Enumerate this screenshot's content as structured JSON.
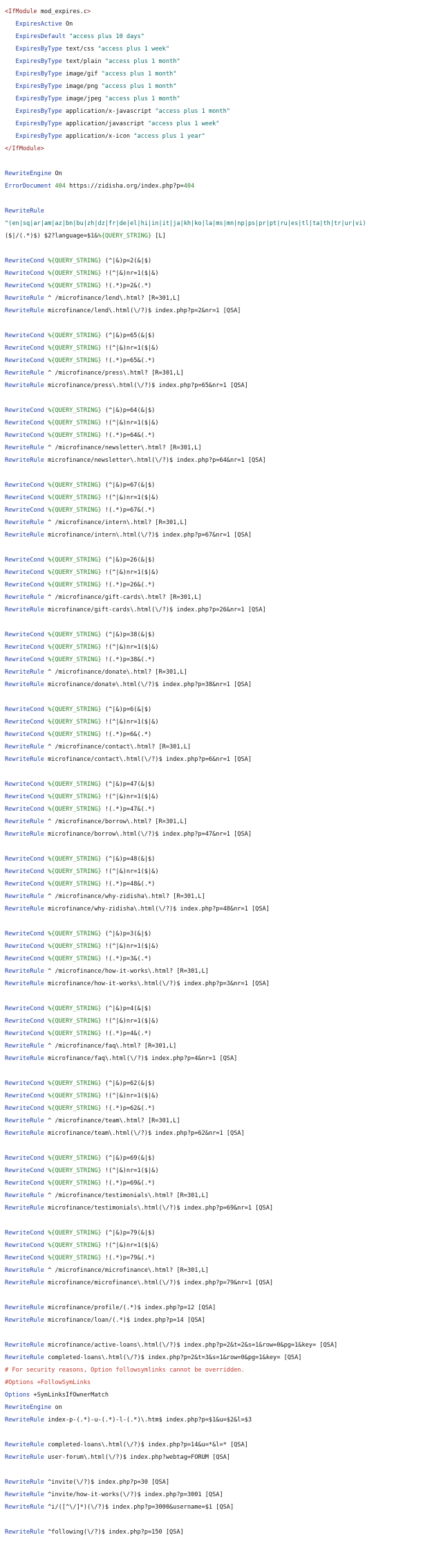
{
  "colors": {
    "background": "#ffffff",
    "tag": "#8b1a1a",
    "directive": "#1a3ea6",
    "variable": "#2d7d2d",
    "number": "#2d7d2d",
    "string": "#0a6b6b",
    "text": "#111111",
    "comment": "#c0392b"
  },
  "lines": [
    [
      [
        "tag",
        "<IfModule"
      ],
      [
        "txt",
        " mod_expires.c"
      ],
      [
        "tag",
        ">"
      ]
    ],
    [
      [
        "txt",
        "   "
      ],
      [
        "dir",
        "ExpiresActive"
      ],
      [
        "txt",
        " On"
      ]
    ],
    [
      [
        "txt",
        "   "
      ],
      [
        "dir",
        "ExpiresDefault"
      ],
      [
        "str",
        " \"access plus 10 days\""
      ]
    ],
    [
      [
        "txt",
        "   "
      ],
      [
        "dir",
        "ExpiresByType"
      ],
      [
        "txt",
        " text/css "
      ],
      [
        "str",
        "\"access plus 1 week\""
      ]
    ],
    [
      [
        "txt",
        "   "
      ],
      [
        "dir",
        "ExpiresByType"
      ],
      [
        "txt",
        " text/plain "
      ],
      [
        "str",
        "\"access plus 1 month\""
      ]
    ],
    [
      [
        "txt",
        "   "
      ],
      [
        "dir",
        "ExpiresByType"
      ],
      [
        "txt",
        " image/gif "
      ],
      [
        "str",
        "\"access plus 1 month\""
      ]
    ],
    [
      [
        "txt",
        "   "
      ],
      [
        "dir",
        "ExpiresByType"
      ],
      [
        "txt",
        " image/png "
      ],
      [
        "str",
        "\"access plus 1 month\""
      ]
    ],
    [
      [
        "txt",
        "   "
      ],
      [
        "dir",
        "ExpiresByType"
      ],
      [
        "txt",
        " image/jpeg "
      ],
      [
        "str",
        "\"access plus 1 month\""
      ]
    ],
    [
      [
        "txt",
        "   "
      ],
      [
        "dir",
        "ExpiresByType"
      ],
      [
        "txt",
        " application/x-javascript "
      ],
      [
        "str",
        "\"access plus 1 month\""
      ]
    ],
    [
      [
        "txt",
        "   "
      ],
      [
        "dir",
        "ExpiresByType"
      ],
      [
        "txt",
        " application/javascript "
      ],
      [
        "str",
        "\"access plus 1 week\""
      ]
    ],
    [
      [
        "txt",
        "   "
      ],
      [
        "dir",
        "ExpiresByType"
      ],
      [
        "txt",
        " application/x-icon "
      ],
      [
        "str",
        "\"access plus 1 year\""
      ]
    ],
    [
      [
        "tag",
        "</IfModule>"
      ]
    ],
    [],
    [
      [
        "dir",
        "RewriteEngine"
      ],
      [
        "txt",
        " On"
      ]
    ],
    [
      [
        "dir",
        "ErrorDocument"
      ],
      [
        "num",
        " 404"
      ],
      [
        "txt",
        " https://zidisha.org/index.php?p="
      ],
      [
        "num",
        "404"
      ]
    ],
    [],
    [
      [
        "dir",
        "RewriteRule"
      ]
    ],
    [
      [
        "str",
        "^(en|sq|ar|am|az|bn|bu|zh|dz|fr|de|el|hi|in|it|ja|kh|ko|la|ms|mn|np|ps|pr|pt|ru|es|tl|ta|th|tr|ur|vi)"
      ]
    ],
    [
      [
        "txt",
        "($|/(.*)$) $2?language=$1&"
      ],
      [
        "var",
        "%{QUERY_STRING}"
      ],
      [
        "txt",
        " [L]"
      ]
    ],
    [],
    [
      [
        "dir",
        "RewriteCond"
      ],
      [
        "var",
        " %{QUERY_STRING}"
      ],
      [
        "txt",
        " (^|&)p=2(&|$)"
      ]
    ],
    [
      [
        "dir",
        "RewriteCond"
      ],
      [
        "var",
        " %{QUERY_STRING}"
      ],
      [
        "txt",
        " !(^|&)nr=1($|&)"
      ]
    ],
    [
      [
        "dir",
        "RewriteCond"
      ],
      [
        "var",
        " %{QUERY_STRING}"
      ],
      [
        "txt",
        " !(.*)p=2&(.*)"
      ]
    ],
    [
      [
        "dir",
        "RewriteRule"
      ],
      [
        "txt",
        " ^ /microfinance/lend\\.html? [R=301,L]"
      ]
    ],
    [
      [
        "dir",
        "RewriteRule"
      ],
      [
        "txt",
        " microfinance/lend\\.html(\\/?)$ index.php?p=2&nr=1 [QSA]"
      ]
    ],
    [],
    [
      [
        "dir",
        "RewriteCond"
      ],
      [
        "var",
        " %{QUERY_STRING}"
      ],
      [
        "txt",
        " (^|&)p=65(&|$)"
      ]
    ],
    [
      [
        "dir",
        "RewriteCond"
      ],
      [
        "var",
        " %{QUERY_STRING}"
      ],
      [
        "txt",
        " !(^|&)nr=1($|&)"
      ]
    ],
    [
      [
        "dir",
        "RewriteCond"
      ],
      [
        "var",
        " %{QUERY_STRING}"
      ],
      [
        "txt",
        " !(.*)p=65&(.*)"
      ]
    ],
    [
      [
        "dir",
        "RewriteRule"
      ],
      [
        "txt",
        " ^ /microfinance/press\\.html? [R=301,L]"
      ]
    ],
    [
      [
        "dir",
        "RewriteRule"
      ],
      [
        "txt",
        " microfinance/press\\.html(\\/?)$ index.php?p=65&nr=1 [QSA]"
      ]
    ],
    [],
    [
      [
        "dir",
        "RewriteCond"
      ],
      [
        "var",
        " %{QUERY_STRING}"
      ],
      [
        "txt",
        " (^|&)p=64(&|$)"
      ]
    ],
    [
      [
        "dir",
        "RewriteCond"
      ],
      [
        "var",
        " %{QUERY_STRING}"
      ],
      [
        "txt",
        " !(^|&)nr=1($|&)"
      ]
    ],
    [
      [
        "dir",
        "RewriteCond"
      ],
      [
        "var",
        " %{QUERY_STRING}"
      ],
      [
        "txt",
        " !(.*)p=64&(.*)"
      ]
    ],
    [
      [
        "dir",
        "RewriteRule"
      ],
      [
        "txt",
        " ^ /microfinance/newsletter\\.html? [R=301,L]"
      ]
    ],
    [
      [
        "dir",
        "RewriteRule"
      ],
      [
        "txt",
        " microfinance/newsletter\\.html(\\/?)$ index.php?p=64&nr=1 [QSA]"
      ]
    ],
    [],
    [
      [
        "dir",
        "RewriteCond"
      ],
      [
        "var",
        " %{QUERY_STRING}"
      ],
      [
        "txt",
        " (^|&)p=67(&|$)"
      ]
    ],
    [
      [
        "dir",
        "RewriteCond"
      ],
      [
        "var",
        " %{QUERY_STRING}"
      ],
      [
        "txt",
        " !(^|&)nr=1($|&)"
      ]
    ],
    [
      [
        "dir",
        "RewriteCond"
      ],
      [
        "var",
        " %{QUERY_STRING}"
      ],
      [
        "txt",
        " !(.*)p=67&(.*)"
      ]
    ],
    [
      [
        "dir",
        "RewriteRule"
      ],
      [
        "txt",
        " ^ /microfinance/intern\\.html? [R=301,L]"
      ]
    ],
    [
      [
        "dir",
        "RewriteRule"
      ],
      [
        "txt",
        " microfinance/intern\\.html(\\/?)$ index.php?p=67&nr=1 [QSA]"
      ]
    ],
    [],
    [
      [
        "dir",
        "RewriteCond"
      ],
      [
        "var",
        " %{QUERY_STRING}"
      ],
      [
        "txt",
        " (^|&)p=26(&|$)"
      ]
    ],
    [
      [
        "dir",
        "RewriteCond"
      ],
      [
        "var",
        " %{QUERY_STRING}"
      ],
      [
        "txt",
        " !(^|&)nr=1($|&)"
      ]
    ],
    [
      [
        "dir",
        "RewriteCond"
      ],
      [
        "var",
        " %{QUERY_STRING}"
      ],
      [
        "txt",
        " !(.*)p=26&(.*)"
      ]
    ],
    [
      [
        "dir",
        "RewriteRule"
      ],
      [
        "txt",
        " ^ /microfinance/gift-cards\\.html? [R=301,L]"
      ]
    ],
    [
      [
        "dir",
        "RewriteRule"
      ],
      [
        "txt",
        " microfinance/gift-cards\\.html(\\/?)$ index.php?p=26&nr=1 [QSA]"
      ]
    ],
    [],
    [
      [
        "dir",
        "RewriteCond"
      ],
      [
        "var",
        " %{QUERY_STRING}"
      ],
      [
        "txt",
        " (^|&)p=38(&|$)"
      ]
    ],
    [
      [
        "dir",
        "RewriteCond"
      ],
      [
        "var",
        " %{QUERY_STRING}"
      ],
      [
        "txt",
        " !(^|&)nr=1($|&)"
      ]
    ],
    [
      [
        "dir",
        "RewriteCond"
      ],
      [
        "var",
        " %{QUERY_STRING}"
      ],
      [
        "txt",
        " !(.*)p=38&(.*)"
      ]
    ],
    [
      [
        "dir",
        "RewriteRule"
      ],
      [
        "txt",
        " ^ /microfinance/donate\\.html? [R=301,L]"
      ]
    ],
    [
      [
        "dir",
        "RewriteRule"
      ],
      [
        "txt",
        " microfinance/donate\\.html(\\/?)$ index.php?p=38&nr=1 [QSA]"
      ]
    ],
    [],
    [
      [
        "dir",
        "RewriteCond"
      ],
      [
        "var",
        " %{QUERY_STRING}"
      ],
      [
        "txt",
        " (^|&)p=6(&|$)"
      ]
    ],
    [
      [
        "dir",
        "RewriteCond"
      ],
      [
        "var",
        " %{QUERY_STRING}"
      ],
      [
        "txt",
        " !(^|&)nr=1($|&)"
      ]
    ],
    [
      [
        "dir",
        "RewriteCond"
      ],
      [
        "var",
        " %{QUERY_STRING}"
      ],
      [
        "txt",
        " !(.*)p=6&(.*)"
      ]
    ],
    [
      [
        "dir",
        "RewriteRule"
      ],
      [
        "txt",
        " ^ /microfinance/contact\\.html? [R=301,L]"
      ]
    ],
    [
      [
        "dir",
        "RewriteRule"
      ],
      [
        "txt",
        " microfinance/contact\\.html(\\/?)$ index.php?p=6&nr=1 [QSA]"
      ]
    ],
    [],
    [
      [
        "dir",
        "RewriteCond"
      ],
      [
        "var",
        " %{QUERY_STRING}"
      ],
      [
        "txt",
        " (^|&)p=47(&|$)"
      ]
    ],
    [
      [
        "dir",
        "RewriteCond"
      ],
      [
        "var",
        " %{QUERY_STRING}"
      ],
      [
        "txt",
        " !(^|&)nr=1($|&)"
      ]
    ],
    [
      [
        "dir",
        "RewriteCond"
      ],
      [
        "var",
        " %{QUERY_STRING}"
      ],
      [
        "txt",
        " !(.*)p=47&(.*)"
      ]
    ],
    [
      [
        "dir",
        "RewriteRule"
      ],
      [
        "txt",
        " ^ /microfinance/borrow\\.html? [R=301,L]"
      ]
    ],
    [
      [
        "dir",
        "RewriteRule"
      ],
      [
        "txt",
        " microfinance/borrow\\.html(\\/?)$ index.php?p=47&nr=1 [QSA]"
      ]
    ],
    [],
    [
      [
        "dir",
        "RewriteCond"
      ],
      [
        "var",
        " %{QUERY_STRING}"
      ],
      [
        "txt",
        " (^|&)p=48(&|$)"
      ]
    ],
    [
      [
        "dir",
        "RewriteCond"
      ],
      [
        "var",
        " %{QUERY_STRING}"
      ],
      [
        "txt",
        " !(^|&)nr=1($|&)"
      ]
    ],
    [
      [
        "dir",
        "RewriteCond"
      ],
      [
        "var",
        " %{QUERY_STRING}"
      ],
      [
        "txt",
        " !(.*)p=48&(.*)"
      ]
    ],
    [
      [
        "dir",
        "RewriteRule"
      ],
      [
        "txt",
        " ^ /microfinance/why-zidisha\\.html? [R=301,L]"
      ]
    ],
    [
      [
        "dir",
        "RewriteRule"
      ],
      [
        "txt",
        " microfinance/why-zidisha\\.html(\\/?)$ index.php?p=48&nr=1 [QSA]"
      ]
    ],
    [],
    [
      [
        "dir",
        "RewriteCond"
      ],
      [
        "var",
        " %{QUERY_STRING}"
      ],
      [
        "txt",
        " (^|&)p=3(&|$)"
      ]
    ],
    [
      [
        "dir",
        "RewriteCond"
      ],
      [
        "var",
        " %{QUERY_STRING}"
      ],
      [
        "txt",
        " !(^|&)nr=1($|&)"
      ]
    ],
    [
      [
        "dir",
        "RewriteCond"
      ],
      [
        "var",
        " %{QUERY_STRING}"
      ],
      [
        "txt",
        " !(.*)p=3&(.*)"
      ]
    ],
    [
      [
        "dir",
        "RewriteRule"
      ],
      [
        "txt",
        " ^ /microfinance/how-it-works\\.html? [R=301,L]"
      ]
    ],
    [
      [
        "dir",
        "RewriteRule"
      ],
      [
        "txt",
        " microfinance/how-it-works\\.html(\\/?)$ index.php?p=3&nr=1 [QSA]"
      ]
    ],
    [],
    [
      [
        "dir",
        "RewriteCond"
      ],
      [
        "var",
        " %{QUERY_STRING}"
      ],
      [
        "txt",
        " (^|&)p=4(&|$)"
      ]
    ],
    [
      [
        "dir",
        "RewriteCond"
      ],
      [
        "var",
        " %{QUERY_STRING}"
      ],
      [
        "txt",
        " !(^|&)nr=1($|&)"
      ]
    ],
    [
      [
        "dir",
        "RewriteCond"
      ],
      [
        "var",
        " %{QUERY_STRING}"
      ],
      [
        "txt",
        " !(.*)p=4&(.*)"
      ]
    ],
    [
      [
        "dir",
        "RewriteRule"
      ],
      [
        "txt",
        " ^ /microfinance/faq\\.html? [R=301,L]"
      ]
    ],
    [
      [
        "dir",
        "RewriteRule"
      ],
      [
        "txt",
        " microfinance/faq\\.html(\\/?)$ index.php?p=4&nr=1 [QSA]"
      ]
    ],
    [],
    [
      [
        "dir",
        "RewriteCond"
      ],
      [
        "var",
        " %{QUERY_STRING}"
      ],
      [
        "txt",
        " (^|&)p=62(&|$)"
      ]
    ],
    [
      [
        "dir",
        "RewriteCond"
      ],
      [
        "var",
        " %{QUERY_STRING}"
      ],
      [
        "txt",
        " !(^|&)nr=1($|&)"
      ]
    ],
    [
      [
        "dir",
        "RewriteCond"
      ],
      [
        "var",
        " %{QUERY_STRING}"
      ],
      [
        "txt",
        " !(.*)p=62&(.*)"
      ]
    ],
    [
      [
        "dir",
        "RewriteRule"
      ],
      [
        "txt",
        " ^ /microfinance/team\\.html? [R=301,L]"
      ]
    ],
    [
      [
        "dir",
        "RewriteRule"
      ],
      [
        "txt",
        " microfinance/team\\.html(\\/?)$ index.php?p=62&nr=1 [QSA]"
      ]
    ],
    [],
    [
      [
        "dir",
        "RewriteCond"
      ],
      [
        "var",
        " %{QUERY_STRING}"
      ],
      [
        "txt",
        " (^|&)p=69(&|$)"
      ]
    ],
    [
      [
        "dir",
        "RewriteCond"
      ],
      [
        "var",
        " %{QUERY_STRING}"
      ],
      [
        "txt",
        " !(^|&)nr=1($|&)"
      ]
    ],
    [
      [
        "dir",
        "RewriteCond"
      ],
      [
        "var",
        " %{QUERY_STRING}"
      ],
      [
        "txt",
        " !(.*)p=69&(.*)"
      ]
    ],
    [
      [
        "dir",
        "RewriteRule"
      ],
      [
        "txt",
        " ^ /microfinance/testimonials\\.html? [R=301,L]"
      ]
    ],
    [
      [
        "dir",
        "RewriteRule"
      ],
      [
        "txt",
        " microfinance/testimonials\\.html(\\/?)$ index.php?p=69&nr=1 [QSA]"
      ]
    ],
    [],
    [
      [
        "dir",
        "RewriteCond"
      ],
      [
        "var",
        " %{QUERY_STRING}"
      ],
      [
        "txt",
        " (^|&)p=79(&|$)"
      ]
    ],
    [
      [
        "dir",
        "RewriteCond"
      ],
      [
        "var",
        " %{QUERY_STRING}"
      ],
      [
        "txt",
        " !(^|&)nr=1($|&)"
      ]
    ],
    [
      [
        "dir",
        "RewriteCond"
      ],
      [
        "var",
        " %{QUERY_STRING}"
      ],
      [
        "txt",
        " !(.*)p=79&(.*)"
      ]
    ],
    [
      [
        "dir",
        "RewriteRule"
      ],
      [
        "txt",
        " ^ /microfinance/microfinance\\.html? [R=301,L]"
      ]
    ],
    [
      [
        "dir",
        "RewriteRule"
      ],
      [
        "txt",
        " microfinance/microfinance\\.html(\\/?)$ index.php?p=79&nr=1 [QSA]"
      ]
    ],
    [],
    [
      [
        "dir",
        "RewriteRule"
      ],
      [
        "txt",
        " microfinance/profile/(.*)$ index.php?p=12 [QSA]"
      ]
    ],
    [
      [
        "dir",
        "RewriteRule"
      ],
      [
        "txt",
        " microfinance/loan/(.*)$ index.php?p=14 [QSA]"
      ]
    ],
    [],
    [
      [
        "dir",
        "RewriteRule"
      ],
      [
        "txt",
        " microfinance/active-loans\\.html(\\/?)$ index.php?p=2&t=2&s=1&row=0&pg=1&key= [QSA]"
      ]
    ],
    [
      [
        "dir",
        "RewriteRule"
      ],
      [
        "txt",
        " completed-loans\\.html(\\/?)$ index.php?p=2&t=3&s=1&row=0&pg=1&key= [QSA]"
      ]
    ],
    [
      [
        "cmt",
        "# For security reasons, Option followsymlinks cannot be overridden."
      ]
    ],
    [
      [
        "cmt",
        "#Options +FollowSymLinks"
      ]
    ],
    [
      [
        "dir",
        "Options"
      ],
      [
        "txt",
        " +SymLinksIfOwnerMatch"
      ]
    ],
    [
      [
        "dir",
        "RewriteEngine"
      ],
      [
        "txt",
        " on"
      ]
    ],
    [
      [
        "dir",
        "RewriteRule"
      ],
      [
        "txt",
        " index-p-(.*)-u-(.*)-l-(.*)\\.htm$ index.php?p=$1&u=$2&l=$3"
      ]
    ],
    [],
    [
      [
        "dir",
        "RewriteRule"
      ],
      [
        "txt",
        " completed-loans\\.html(\\/?)$ index.php?p=14&u=*&l=* [QSA]"
      ]
    ],
    [
      [
        "dir",
        "RewriteRule"
      ],
      [
        "txt",
        " user-forum\\.html(\\/?)$ index.php?webtag=FORUM [QSA]"
      ]
    ],
    [],
    [
      [
        "dir",
        "RewriteRule"
      ],
      [
        "txt",
        " ^invite(\\/?)$ index.php?p=30 [QSA]"
      ]
    ],
    [
      [
        "dir",
        "RewriteRule"
      ],
      [
        "txt",
        " ^invite/how-it-works(\\/?)$ index.php?p=3001 [QSA]"
      ]
    ],
    [
      [
        "dir",
        "RewriteRule"
      ],
      [
        "txt",
        " ^i/([^\\/]*)(\\/?)$ index.php?p=3000&username=$1 [QSA]"
      ]
    ],
    [],
    [
      [
        "dir",
        "RewriteRule"
      ],
      [
        "txt",
        " ^following(\\/?)$ index.php?p=150 [QSA]"
      ]
    ]
  ]
}
